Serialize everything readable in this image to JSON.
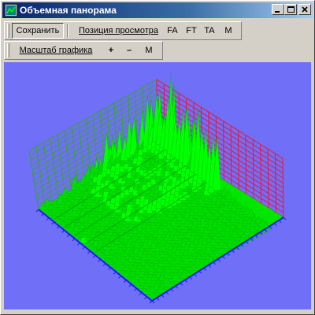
{
  "window": {
    "title": "Объемная панорама"
  },
  "toolbar1": {
    "save_label": "Сохранить",
    "view_position_label": "Позиция просмотра",
    "fa_label": "FA",
    "ft_label": "FT",
    "ta_label": "TA",
    "m_label": "M"
  },
  "toolbar2": {
    "scale_label": "Масштаб графика",
    "plus_label": "+",
    "minus_label": "–",
    "m_label": "M"
  },
  "colors": {
    "plot_background": "#6f6ff7",
    "left_grid": "#3ba23b",
    "right_grid": "#e8173b",
    "floor_axis": "#1a1aff",
    "surface": "#00ff00"
  }
}
